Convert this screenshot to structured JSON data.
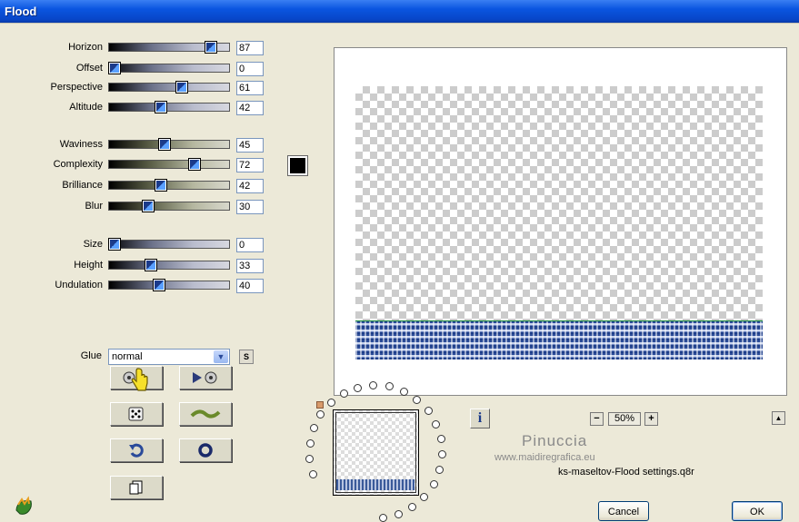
{
  "window": {
    "title": "Flood"
  },
  "colors": {
    "swatch": "#000000",
    "titlebar": "#0a55e0"
  },
  "params": [
    {
      "key": "horizon",
      "label": "Horizon",
      "value": "87",
      "fraction": 0.87,
      "track": "grey"
    },
    {
      "key": "offset",
      "label": "Offset",
      "value": "0",
      "fraction": 0.0,
      "track": "grey"
    },
    {
      "key": "perspective",
      "label": "Perspective",
      "value": "61",
      "fraction": 0.61,
      "track": "grey"
    },
    {
      "key": "altitude",
      "label": "Altitude",
      "value": "42",
      "fraction": 0.42,
      "track": "grey"
    },
    {
      "key": "waviness",
      "label": "Waviness",
      "value": "45",
      "fraction": 0.45,
      "track": "olive"
    },
    {
      "key": "complexity",
      "label": "Complexity",
      "value": "72",
      "fraction": 0.72,
      "track": "olive"
    },
    {
      "key": "brilliance",
      "label": "Brilliance",
      "value": "42",
      "fraction": 0.42,
      "track": "olive"
    },
    {
      "key": "blur",
      "label": "Blur",
      "value": "30",
      "fraction": 0.3,
      "track": "olive"
    },
    {
      "key": "size",
      "label": "Size",
      "value": "0",
      "fraction": 0.0,
      "track": "grey"
    },
    {
      "key": "height",
      "label": "Height",
      "value": "33",
      "fraction": 0.33,
      "track": "grey"
    },
    {
      "key": "undulation",
      "label": "Undulation",
      "value": "40",
      "fraction": 0.4,
      "track": "grey"
    }
  ],
  "glue": {
    "label": "Glue",
    "value": "normal",
    "side_button": "S"
  },
  "toolbar_icons": [
    "load-preset-icon",
    "save-preset-icon",
    "randomize-icon",
    "wave-icon",
    "reset-icon",
    "circle-icon",
    "copy-icon"
  ],
  "zoom": {
    "minus": "−",
    "value": "50%",
    "plus": "+"
  },
  "info_label": "i",
  "watermark": {
    "name": "Pinuccia",
    "url": "www.maidiregrafica.eu"
  },
  "preset_file": "ks-maseltov-Flood settings.q8r",
  "buttons": {
    "cancel": "Cancel",
    "ok": "OK"
  }
}
